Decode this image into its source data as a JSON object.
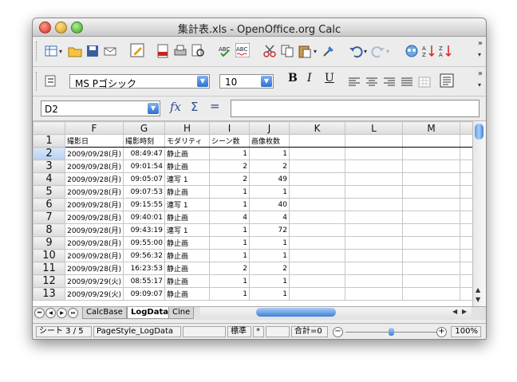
{
  "window": {
    "title": "集計表.xls - OpenOffice.org Calc"
  },
  "toolbar_format": {
    "font_name": "MS Pゴシック",
    "font_size": "10",
    "bold": "B",
    "italic": "I",
    "underline": "U",
    "more": "»"
  },
  "formula_bar": {
    "cell_ref": "D2",
    "function_wizard": "fx",
    "sum": "Σ",
    "equals": "=",
    "value": ""
  },
  "columns": [
    "F",
    "G",
    "H",
    "I",
    "J",
    "K",
    "L",
    "M"
  ],
  "header_row": {
    "row": "1",
    "cells": [
      "撮影日",
      "撮影時刻",
      "モダリティ",
      "シーン数",
      "画像枚数",
      "",
      "",
      ""
    ]
  },
  "rows": [
    {
      "row": "2",
      "date": "2009/09/28(月)",
      "time": "08:49:47",
      "modality": "静止画",
      "scenes": "1",
      "images": "1"
    },
    {
      "row": "3",
      "date": "2009/09/28(月)",
      "time": "09:01:54",
      "modality": "静止画",
      "scenes": "2",
      "images": "2"
    },
    {
      "row": "4",
      "date": "2009/09/28(月)",
      "time": "09:05:07",
      "modality": "連写 1",
      "scenes": "2",
      "images": "49"
    },
    {
      "row": "5",
      "date": "2009/09/28(月)",
      "time": "09:07:53",
      "modality": "静止画",
      "scenes": "1",
      "images": "1"
    },
    {
      "row": "6",
      "date": "2009/09/28(月)",
      "time": "09:15:55",
      "modality": "連写 1",
      "scenes": "1",
      "images": "40"
    },
    {
      "row": "7",
      "date": "2009/09/28(月)",
      "time": "09:40:01",
      "modality": "静止画",
      "scenes": "4",
      "images": "4"
    },
    {
      "row": "8",
      "date": "2009/09/28(月)",
      "time": "09:43:19",
      "modality": "連写 1",
      "scenes": "1",
      "images": "72"
    },
    {
      "row": "9",
      "date": "2009/09/28(月)",
      "time": "09:55:00",
      "modality": "静止画",
      "scenes": "1",
      "images": "1"
    },
    {
      "row": "10",
      "date": "2009/09/28(月)",
      "time": "09:56:32",
      "modality": "静止画",
      "scenes": "1",
      "images": "1"
    },
    {
      "row": "11",
      "date": "2009/09/28(月)",
      "time": "16:23:53",
      "modality": "静止画",
      "scenes": "2",
      "images": "2"
    },
    {
      "row": "12",
      "date": "2009/09/29(火)",
      "time": "08:55:17",
      "modality": "静止画",
      "scenes": "1",
      "images": "1"
    },
    {
      "row": "13",
      "date": "2009/09/29(火)",
      "time": "09:09:07",
      "modality": "静止画",
      "scenes": "1",
      "images": "1"
    }
  ],
  "sheet_tabs": [
    "CalcBase",
    "LogData",
    "Cine"
  ],
  "active_tab": "LogData",
  "status": {
    "sheet": "シート 3 / 5",
    "page_style": "PageStyle_LogData",
    "mode": "標準",
    "modified": "*",
    "sum": "合計=0",
    "zoom": "100%"
  },
  "colors": {
    "selection_row_header": "#b9cfee",
    "scroll_thumb": "#3e7fd8",
    "window_bg": "#ececec"
  }
}
